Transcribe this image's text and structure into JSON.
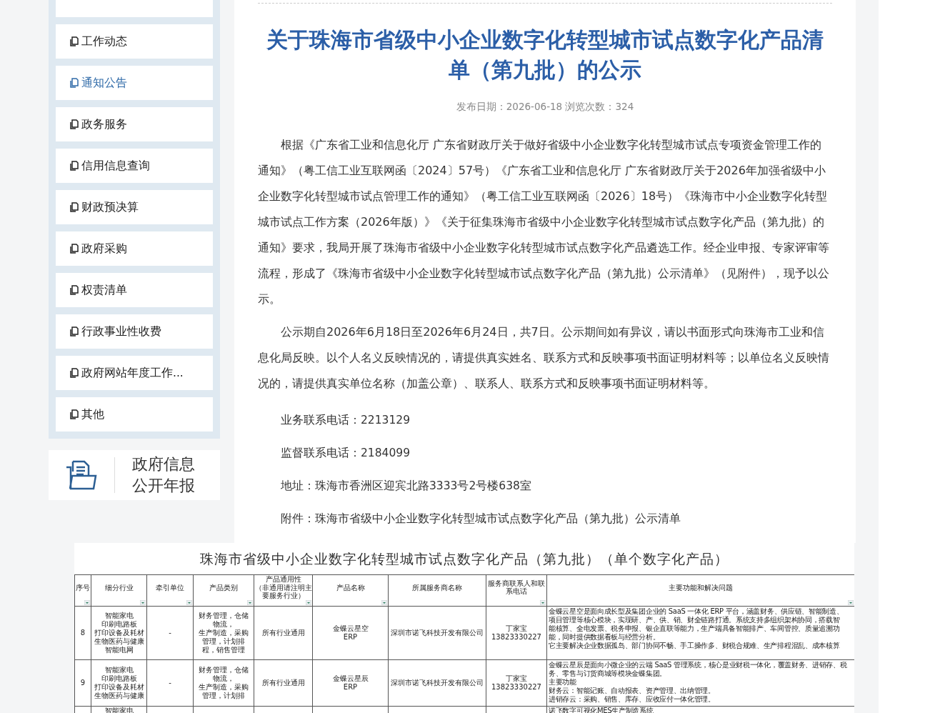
{
  "sidebar": {
    "items": [
      {
        "label": "工作动态",
        "selected": false
      },
      {
        "label": "通知公告",
        "selected": true
      },
      {
        "label": "政务服务",
        "selected": false
      },
      {
        "label": "信用信息查询",
        "selected": false
      },
      {
        "label": "财政预决算",
        "selected": false
      },
      {
        "label": "政府采购",
        "selected": false
      },
      {
        "label": "权责清单",
        "selected": false
      },
      {
        "label": "行政事业性收费",
        "selected": false
      },
      {
        "label": "政府网站年度工作...",
        "selected": false
      },
      {
        "label": "其他",
        "selected": false
      }
    ],
    "banner": {
      "lines": [
        "政府信息",
        "公开年报"
      ]
    }
  },
  "article": {
    "title": "关于珠海市省级中小企业数字化转型城市试点数字化产品清单（第九批）的公示",
    "meta": "发布日期：2026-06-18  浏览次数：324",
    "paragraphs": [
      "根据《广东省工业和信息化厅 广东省财政厅关于做好省级中小企业数字化转型城市试点专项资金管理工作的通知》（粤工信工业互联网函〔2024〕57号）《广东省工业和信息化厅 广东省财政厅关于2026年加强省级中小企业数字化转型城市试点管理工作的通知》（粤工信工业互联网函〔2026〕18号）《珠海市中小企业数字化转型城市试点工作方案（2026年版）》《关于征集珠海市省级中小企业数字化转型城市试点数字化产品（第九批）的通知》要求，我局开展了珠海市省级中小企业数字化转型城市试点数字化产品遴选工作。经企业申报、专家评审等流程，形成了《珠海市省级中小企业数字化转型城市试点数字化产品（第九批）公示清单》（见附件），现予以公示。",
      "公示期自2026年6月18日至2026年6月24日，共7日。公示期间如有异议，请以书面形式向珠海市工业和信息化局反映。以个人名义反映情况的，请提供真实姓名、联系方式和反映事项书面证明材料等；以单位名义反映情况的，请提供真实单位名称（加盖公章）、联系人、联系方式和反映事项书面证明材料等。"
    ],
    "contacts": [
      "业务联系电话：2213129",
      "监督联系电话：2184099",
      "地址：珠海市香洲区迎宾北路3333号2号楼638室",
      "附件：珠海市省级中小企业数字化转型城市试点数字化产品（第九批）公示清单"
    ]
  },
  "table": {
    "caption": "珠海市省级中小企业数字化转型城市试点数字化产品（第九批）（单个数字化产品）",
    "columns": [
      {
        "lines": [
          "序号"
        ],
        "filter": true
      },
      {
        "lines": [
          "细分行业"
        ],
        "filter": true
      },
      {
        "lines": [
          "牵引单位"
        ],
        "filter": true
      },
      {
        "lines": [
          "产品类别"
        ],
        "filter": true
      },
      {
        "lines": [
          "产品通用性",
          "（非通用请注明主",
          "要服务行业）"
        ],
        "filter": true
      },
      {
        "lines": [
          "产品名称"
        ],
        "filter": true
      },
      {
        "lines": [
          "所属服务商名称"
        ],
        "filter": false
      },
      {
        "lines": [
          "服务商联系人和联",
          "系电话"
        ],
        "filter": true
      },
      {
        "lines": [
          "主要功能和解决问题"
        ],
        "filter": true
      }
    ],
    "rows": [
      {
        "cells": [
          [
            "8"
          ],
          [
            "智能家电",
            "印刷电路板",
            "打印设备及耗材",
            "生物医药与健康",
            "智能电网"
          ],
          [
            "-"
          ],
          [
            "财务管理，仓储",
            "物流，",
            "生产制造，采购",
            "管理，计划排",
            "程，销售管理"
          ],
          [
            "所有行业通用"
          ],
          [
            "金蝶云星空",
            "ERP"
          ],
          [
            "深圳市诺飞科技开发有限公司"
          ],
          [
            "丁家宝",
            "13823330227"
          ],
          [
            "金蝶云星空是面向成长型及集团企业的 SaaS 一体化 ERP 平台，涵盖财务、供应链、智能制造、",
            "项目管理等核心模块，实现研、产、供、销、财全链路打通。系统支持多组织架构协同，搭载智",
            "能核算、全电发票、税务申报、银企直联等能力，生产端具备智能排产、车间管控、质量追溯功",
            "能，同时提供数据看板与经营分析。",
            "它主要解决企业数据孤岛、部门协同不畅、手工操作多、财税合规难、生产排程混乱、成本核算"
          ]
        ]
      },
      {
        "cells": [
          [
            "9"
          ],
          [
            "智能家电",
            "印刷电路板",
            "打印设备及耗材",
            "生物医药与健康"
          ],
          [
            "-"
          ],
          [
            "财务管理，仓储",
            "物流，",
            "生产制造，采购",
            "管理，计划排"
          ],
          [
            "所有行业通用"
          ],
          [
            "金蝶云星辰",
            "ERP"
          ],
          [
            "深圳市诺飞科技开发有限公司"
          ],
          [
            "丁家宝",
            "13823330227"
          ],
          [
            "金蝶云星辰是面向小微企业的云端 SaaS 管理系统，核心是业财税一体化，覆盖财务、进销存、税",
            "务、零售与订货商城等模块金蝶集团。",
            "主要功能",
            "财务云：智能记账、自动报表、资产管理、出纳管理。",
            "进销存云：采购、销售、库存、应收应付一体化管理。"
          ]
        ]
      },
      {
        "cells": [
          [],
          [
            "智能家电"
          ],
          [],
          [],
          [],
          [],
          [],
          [],
          [
            "诺飞数字可视化MES生产制造系统"
          ]
        ]
      }
    ]
  }
}
